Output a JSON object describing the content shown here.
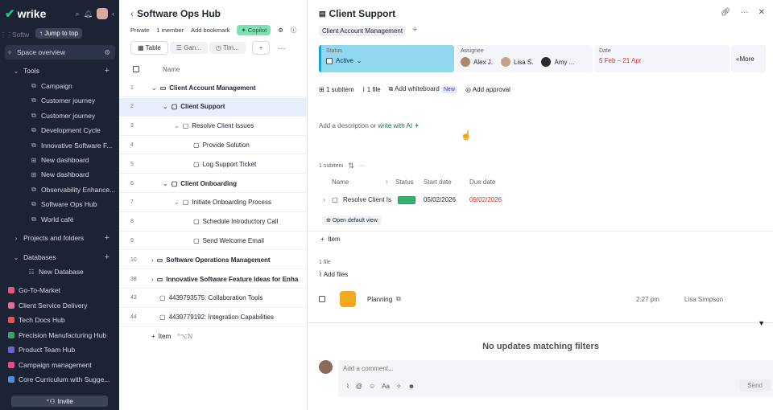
{
  "app": {
    "name": "wrike",
    "jump_to_top": "Jump to top",
    "invite": "Invite",
    "partial_label": "Softw"
  },
  "sidebar": {
    "space_overview": "Space overview",
    "tools_label": "Tools",
    "tools": [
      "Campaign",
      "Customer journey",
      "Customer journey",
      "Development Cycle",
      "Innovative Software F...",
      "New dashboard",
      "New dashboard",
      "Observability Enhance...",
      "Software Ops Hub",
      "World café"
    ],
    "projects_label": "Projects and folders",
    "databases_label": "Databases",
    "new_database": "New Database",
    "hubs": [
      {
        "label": "Go-To-Market",
        "color": "#e0587e"
      },
      {
        "label": "Client Service Delivery",
        "color": "#e06f9b"
      },
      {
        "label": "Tech Docs Hub",
        "color": "#e05358"
      },
      {
        "label": "Precision Manufacturing Hub",
        "color": "#3da06d"
      },
      {
        "label": "Product Team Hub",
        "color": "#6a62d0"
      },
      {
        "label": "Campaign management",
        "color": "#e14c8b"
      },
      {
        "label": "Core Curriculum with Sugge...",
        "color": "#4a8fe0"
      }
    ]
  },
  "main": {
    "title": "Software Ops Hub",
    "meta": {
      "privacy": "Private",
      "members": "1 member",
      "bookmark": "Add bookmark",
      "copilot": "Copilot"
    },
    "tabs": [
      "Table",
      "Gan...",
      "Tim..."
    ],
    "column_name": "Name",
    "rows": [
      {
        "num": "1",
        "label": "Client Account Management",
        "bold": true
      },
      {
        "num": "2",
        "label": "Client Support",
        "bold": true
      },
      {
        "num": "3",
        "label": "Resolve Client Issues",
        "bold": false
      },
      {
        "num": "4",
        "label": "Provide Solution",
        "bold": false
      },
      {
        "num": "5",
        "label": "Log Support Ticket",
        "bold": false
      },
      {
        "num": "6",
        "label": "Client Onboarding",
        "bold": true
      },
      {
        "num": "7",
        "label": "Initiate Onboarding Process",
        "bold": false
      },
      {
        "num": "8",
        "label": "Schedule Introductory Call",
        "bold": false
      },
      {
        "num": "9",
        "label": "Send Welcome Email",
        "bold": false
      },
      {
        "num": "10",
        "label": "Software Operations Management",
        "bold": true
      },
      {
        "num": "38",
        "label": "Innovative Software Feature Ideas for Enha",
        "bold": true
      },
      {
        "num": "43",
        "label": "4439793575: Collaboration Tools",
        "bold": false
      },
      {
        "num": "44",
        "label": "4439779192: Integration Capabilities",
        "bold": false
      }
    ],
    "add_item": "Item",
    "add_item_shortcut": "^⌥N"
  },
  "panel": {
    "title": "Client Support",
    "tag": "Client Account Management",
    "status_label": "Status",
    "status_value": "Active",
    "assignee_label": "Assignee",
    "assignees": [
      "Alex J.",
      "Lisa S.",
      "Amy ..."
    ],
    "date_label": "Date",
    "date_value": "5 Feb – 21 Apr",
    "more": "More",
    "actions": {
      "subitem": "1 subitem",
      "file": "1 file",
      "whiteboard": "Add whiteboard",
      "new_badge": "New",
      "approval": "Add approval"
    },
    "description": {
      "prefix": "Add a description or ",
      "ai": "write with AI"
    },
    "subitems_count": "1 subitem",
    "subitem_headers": {
      "name": "Name",
      "status": "Status",
      "start": "Start date",
      "due": "Due date"
    },
    "subitem": {
      "name": "Resolve Client Is",
      "start": "05/02/2026",
      "due": "09/02/2026"
    },
    "open_default_view": "Open default view",
    "add_item": "Item",
    "files_count": "1 file",
    "add_files": "Add files",
    "file": {
      "name": "Planning",
      "time": "2:27 pm",
      "owner": "Lisa Simpson"
    },
    "no_updates": "No updates matching filters",
    "comment_placeholder": "Add a comment...",
    "send": "Send"
  }
}
